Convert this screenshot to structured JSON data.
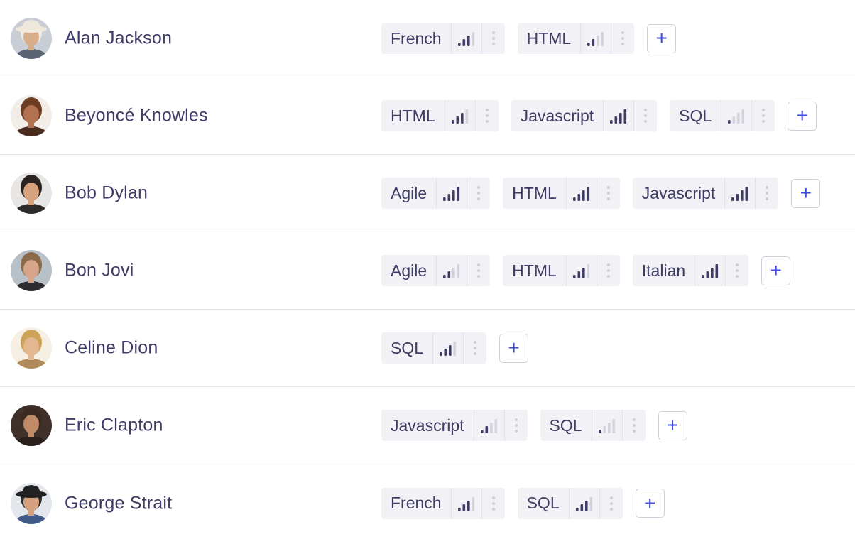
{
  "colors": {
    "bar_active": "#3f3d63",
    "bar_inactive": "#d3d3de",
    "add_accent": "#3d4bd8"
  },
  "people": [
    {
      "name": "Alan Jackson",
      "avatar": {
        "icon": "person-avatar",
        "skin": "#d8ad8c",
        "hair": "#f0ece4",
        "bg": "#c9ced6",
        "shirt": "#5b6473",
        "hat": "#efe8dc"
      },
      "skills": [
        {
          "label": "French",
          "level": 3
        },
        {
          "label": "HTML",
          "level": 2
        }
      ],
      "add_label": "+"
    },
    {
      "name": "Beyoncé Knowles",
      "avatar": {
        "icon": "person-avatar",
        "skin": "#b27150",
        "hair": "#6b3c22",
        "bg": "#f2ede8",
        "shirt": "#4a2c1e"
      },
      "skills": [
        {
          "label": "HTML",
          "level": 3
        },
        {
          "label": "Javascript",
          "level": 4
        },
        {
          "label": "SQL",
          "level": 1
        }
      ],
      "add_label": "+"
    },
    {
      "name": "Bob Dylan",
      "avatar": {
        "icon": "person-avatar",
        "skin": "#d8a17e",
        "hair": "#2b231f",
        "bg": "#e8e6e4",
        "shirt": "#2d2a2a"
      },
      "skills": [
        {
          "label": "Agile",
          "level": 4
        },
        {
          "label": "HTML",
          "level": 4
        },
        {
          "label": "Javascript",
          "level": 4
        }
      ],
      "add_label": "+"
    },
    {
      "name": "Bon Jovi",
      "avatar": {
        "icon": "person-avatar",
        "skin": "#d7a58a",
        "hair": "#8a6a48",
        "bg": "#b8c0c8",
        "shirt": "#2b2b30"
      },
      "skills": [
        {
          "label": "Agile",
          "level": 2
        },
        {
          "label": "HTML",
          "level": 3
        },
        {
          "label": "Italian",
          "level": 4
        }
      ],
      "add_label": "+"
    },
    {
      "name": "Celine Dion",
      "avatar": {
        "icon": "person-avatar",
        "skin": "#e3b890",
        "hair": "#cfa25a",
        "bg": "#f6efe3",
        "shirt": "#b08a5a"
      },
      "skills": [
        {
          "label": "SQL",
          "level": 3
        }
      ],
      "add_label": "+"
    },
    {
      "name": "Eric Clapton",
      "avatar": {
        "icon": "person-avatar",
        "skin": "#c08a68",
        "hair": "#3b2a20",
        "bg": "#40302a",
        "shirt": "#2a201c"
      },
      "skills": [
        {
          "label": "Javascript",
          "level": 2
        },
        {
          "label": "SQL",
          "level": 1
        }
      ],
      "add_label": "+"
    },
    {
      "name": "George Strait",
      "avatar": {
        "icon": "person-avatar",
        "skin": "#d4a07f",
        "hair": "#2b2b2b",
        "bg": "#e3e6ea",
        "shirt": "#3f5a86",
        "hat": "#222222"
      },
      "skills": [
        {
          "label": "French",
          "level": 3
        },
        {
          "label": "SQL",
          "level": 3
        }
      ],
      "add_label": "+"
    }
  ]
}
